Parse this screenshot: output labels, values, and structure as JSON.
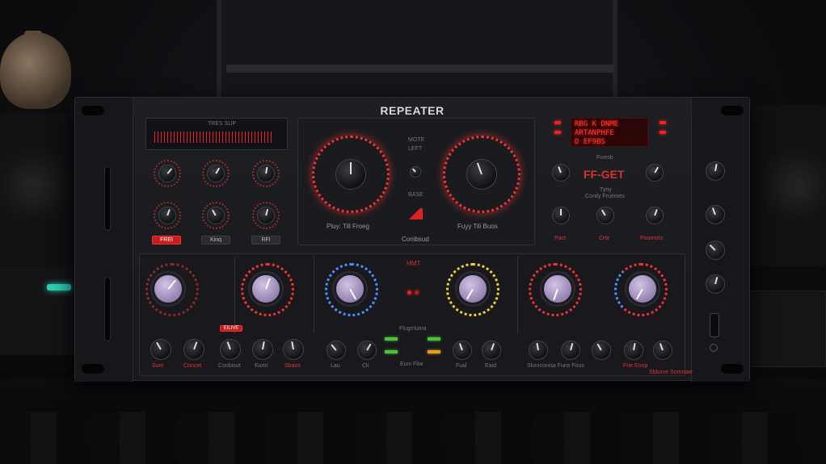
{
  "device": {
    "title": "REPEATER"
  },
  "meter": {
    "label": "TRES SUP"
  },
  "top_left": {
    "buttons": [
      "FREI",
      "Kinq",
      "RFI"
    ]
  },
  "center": {
    "top_label_1": "MOTE",
    "top_label_2": "LEFT",
    "middle_label": "BASE",
    "left_dial_label": "Pluy: Till Froeg",
    "right_dial_label": "Fuyy Tili Buos",
    "bottom_label": "Conibsud"
  },
  "display": {
    "lines": [
      "RBG K DNME",
      "ARTANPHFE",
      "D EF9BS"
    ],
    "mode_label": "Fivesb",
    "preset_name": "FF-GET",
    "sub_label_1": "Tyny",
    "sub_label_2": "Conily Fruenies",
    "bottom_labels": [
      "Pact",
      "Crtir",
      "Poarnots"
    ]
  },
  "lower": {
    "hmt_label": "HMT",
    "middle_label": "Flugrrluma",
    "middle_bottom_label": "Euni Fliw",
    "red_button": "EILIVE",
    "labels_row": [
      "Sum",
      "Concet",
      "Conbisut",
      "Eumt",
      "Sbans",
      "Lau",
      "Cli",
      "Fual",
      "Eaid"
    ],
    "right_text": "Sloniconisa Funs Fous",
    "right_labels": [
      "Frie Eonp",
      "Sbbone Somnaie"
    ]
  },
  "colors": {
    "accent_red": "#e33333",
    "accent_blue": "#4a8fff",
    "accent_yellow": "#f3d227",
    "knob_lavender": "#b3a2cc",
    "lcd_red": "#ff3b2f"
  }
}
